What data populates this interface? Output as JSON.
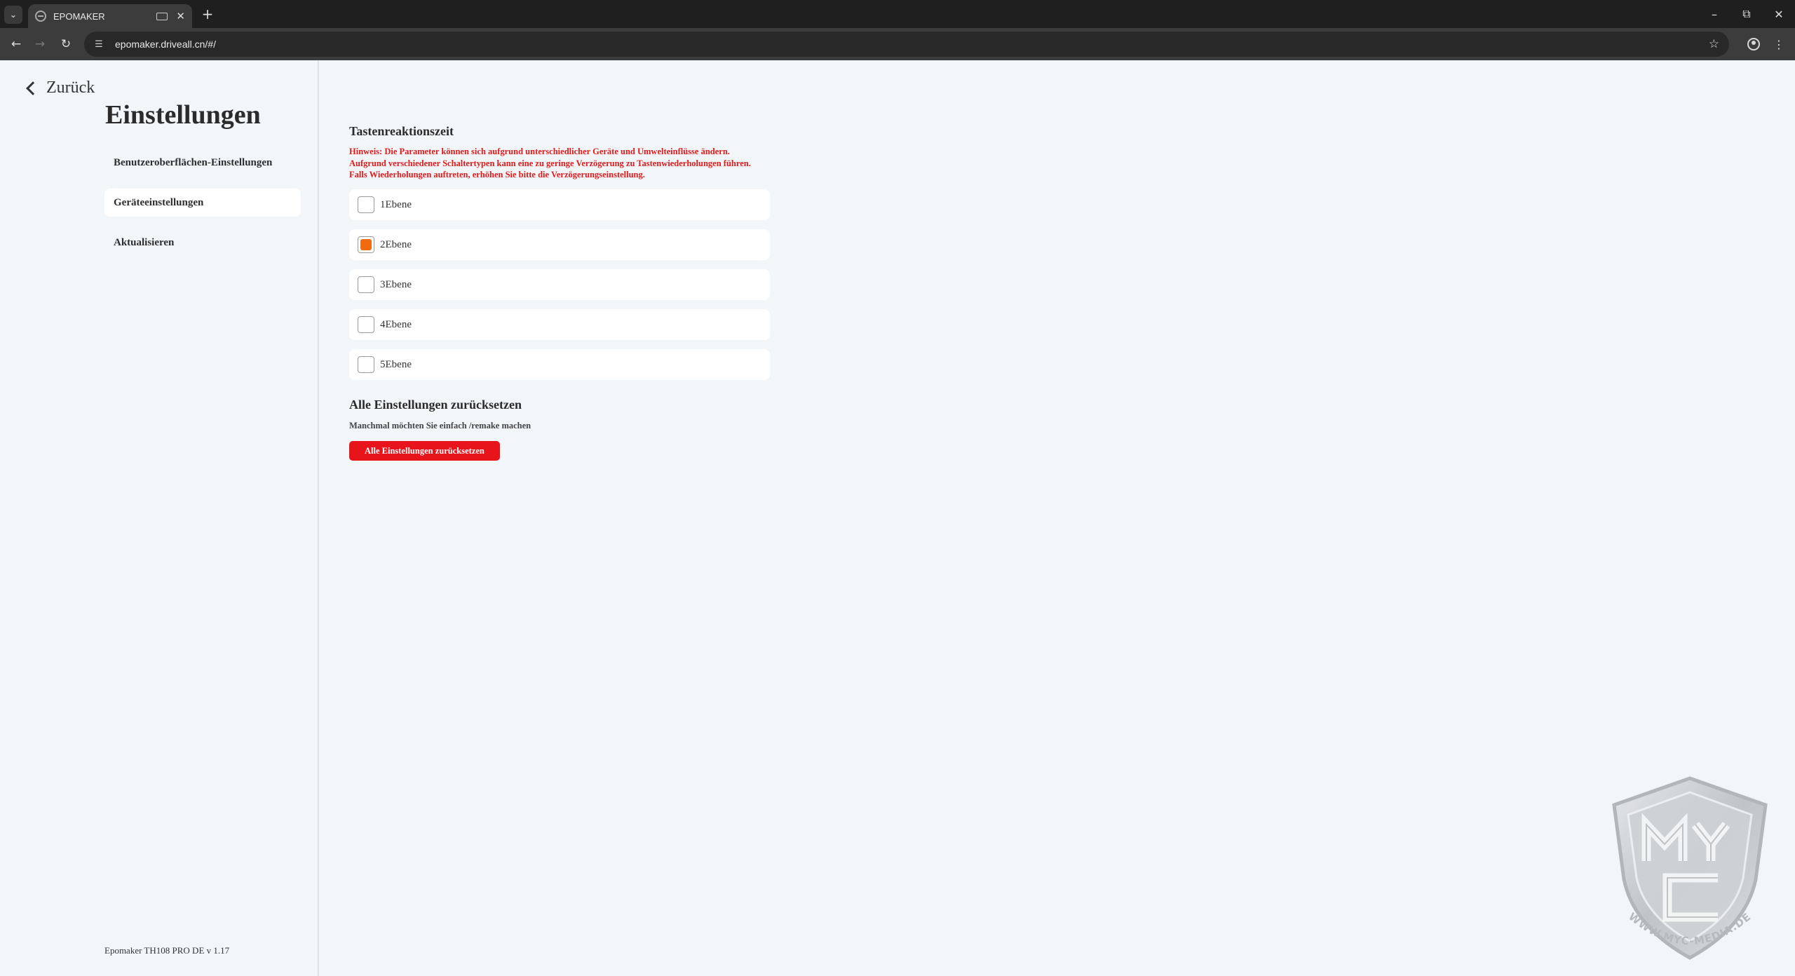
{
  "browser": {
    "tab_title": "EPOMAKER",
    "url": "epomaker.driveall.cn/#/",
    "icons": {
      "tab_list": "chevron-down-icon",
      "new_tab": "plus-icon",
      "back": "arrow-left-icon",
      "forward": "arrow-right-icon",
      "reload": "reload-icon",
      "site_info": "tune-icon",
      "bookmark": "star-icon",
      "profile": "profile-icon",
      "menu": "kebab-menu-icon"
    }
  },
  "sidebar": {
    "back_label": "Zurück",
    "title": "Einstellungen",
    "items": [
      {
        "label": "Benutzeroberflächen-Einstellungen",
        "active": false
      },
      {
        "label": "Geräteeinstellungen",
        "active": true
      },
      {
        "label": "Aktualisieren",
        "active": false
      }
    ],
    "version": "Epomaker TH108 PRO DE v 1.17"
  },
  "main": {
    "response_section": {
      "title": "Tastenreaktionszeit",
      "hint_lines": [
        "Hinweis: Die Parameter können sich aufgrund unterschiedlicher Geräte und Umwelteinflüsse ändern.",
        "Aufgrund verschiedener Schaltertypen kann eine zu geringe Verzögerung zu Tastenwiederholungen führen.",
        "Falls Wiederholungen auftreten, erhöhen Sie bitte die Verzögerungseinstellung."
      ],
      "options": [
        {
          "label": "1Ebene",
          "selected": false
        },
        {
          "label": "2Ebene",
          "selected": true
        },
        {
          "label": "3Ebene",
          "selected": false
        },
        {
          "label": "4Ebene",
          "selected": false
        },
        {
          "label": "5Ebene",
          "selected": false
        }
      ]
    },
    "reset_section": {
      "title": "Alle Einstellungen zurücksetzen",
      "subtitle": "Manchmal möchten Sie einfach /remake machen",
      "button_label": "Alle Einstellungen zurücksetzen"
    }
  },
  "watermark": {
    "logo_text": "MYC",
    "url_text": "WWW.MYC-MEDIA.DE"
  },
  "colors": {
    "accent_orange": "#ee6c0f",
    "danger_red": "#e8141c",
    "hint_red": "#e01b1b",
    "page_background": "#f3f6f9"
  }
}
